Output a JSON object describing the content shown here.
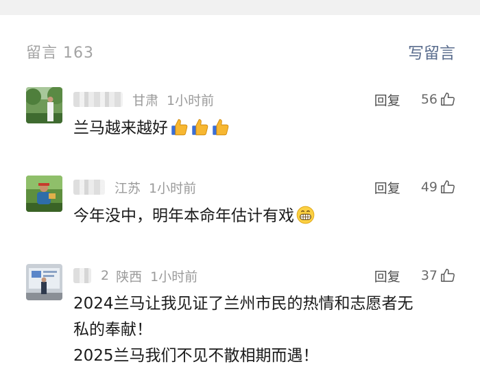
{
  "header": {
    "count_label": "留言 163",
    "write_label": "写留言"
  },
  "comments": [
    {
      "location": "甘肃",
      "time": "1小时前",
      "reply_label": "回复",
      "likes": "56",
      "text": "兰马越来越好"
    },
    {
      "location": "江苏",
      "time": "1小时前",
      "reply_label": "回复",
      "likes": "49",
      "text": "今年没中，明年本命年估计有戏"
    },
    {
      "location": "陕西",
      "time": "1小时前",
      "reply_label": "回复",
      "likes": "37",
      "name_fragment": "2",
      "text_line1": "2024兰马让我见证了兰州市民的热情和志愿者无",
      "text_line2": "私的奉献！",
      "text_line3": "2025兰马我们不见不散相期而遇！"
    }
  ],
  "icons": [
    "thumbs-up-outline-icon",
    "thumbs-up-emoji-icon",
    "grinning-face-emoji-icon"
  ],
  "colors": {
    "link": "#586b8c",
    "muted": "#9a9a9a",
    "text": "#1a1a1a"
  }
}
